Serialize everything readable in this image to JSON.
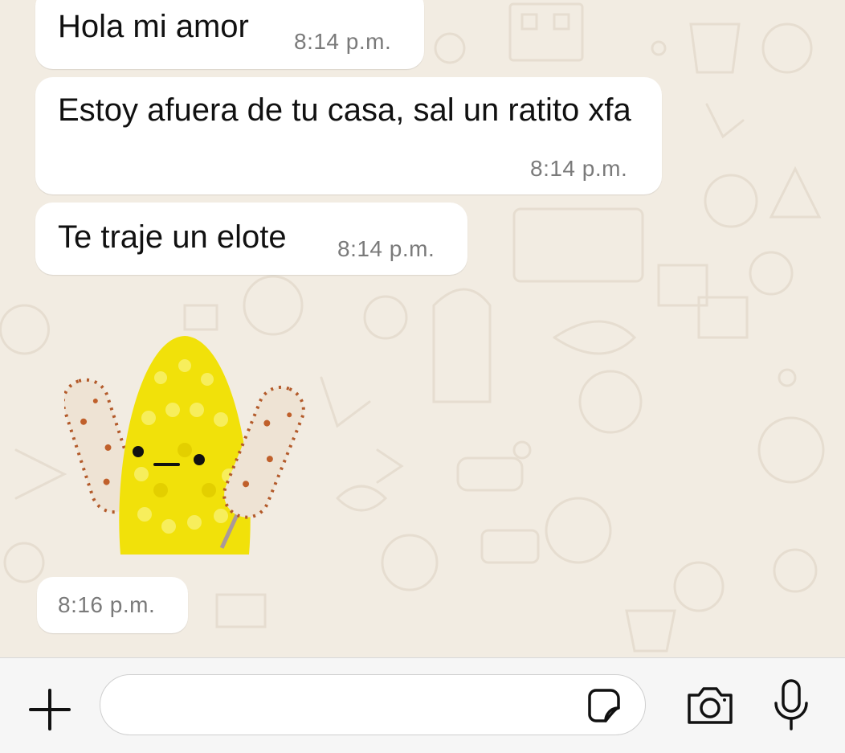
{
  "messages": [
    {
      "text": "Hola mi amor",
      "time": "8:14 p.m."
    },
    {
      "text": "Estoy afuera de tu casa, sal un ratito xfa",
      "time": "8:14 p.m."
    },
    {
      "text": "Te traje un elote",
      "time": "8:14 p.m."
    }
  ],
  "sticker": {
    "subject": "corn-cob-elote",
    "time": "8:16 p.m."
  },
  "composer": {
    "placeholder": "",
    "value": ""
  },
  "colors": {
    "chat_bg": "#f2ece2",
    "bubble": "#ffffff",
    "time": "#7a7a7a",
    "corn": "#f1e10a"
  }
}
